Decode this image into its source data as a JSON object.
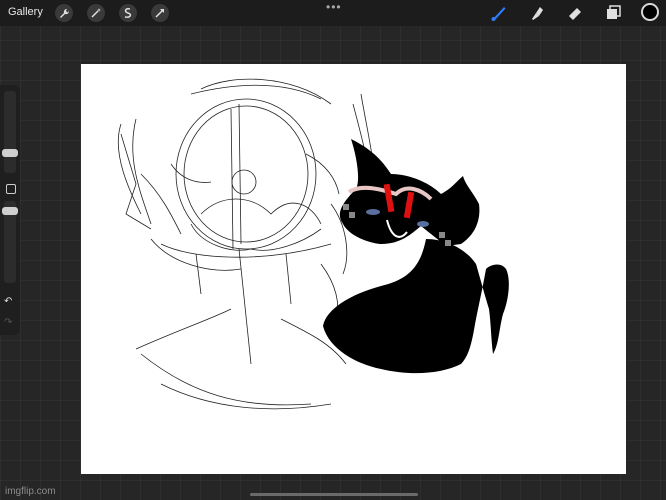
{
  "topbar": {
    "gallery_label": "Gallery",
    "left_tools": [
      "wrench-icon",
      "magic-wand-icon",
      "selection-icon",
      "transform-arrow-icon"
    ],
    "more_label": "•••",
    "right_tools": [
      "brush-icon",
      "smudge-icon",
      "eraser-icon",
      "layers-icon"
    ],
    "active_color": "#000000",
    "accent_color": "#2f7cf6"
  },
  "sidebar": {
    "controls": [
      "brush-size-slider",
      "modify-button",
      "opacity-slider",
      "undo-icon",
      "redo-icon"
    ]
  },
  "watermark": {
    "text": "imgflip.com"
  }
}
